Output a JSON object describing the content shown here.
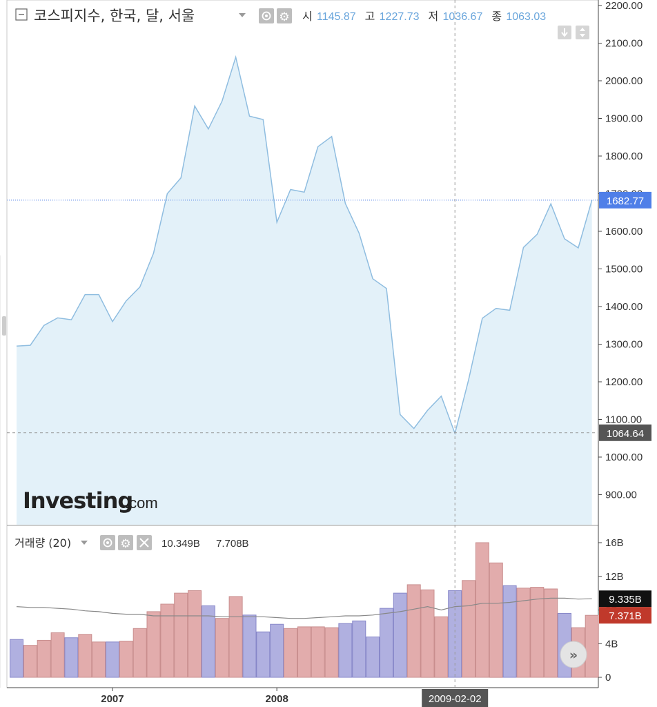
{
  "header": {
    "title": "코스피지수, 한국, 달, 서울",
    "ohlc": [
      {
        "label": "시",
        "value": "1145.87"
      },
      {
        "label": "고",
        "value": "1227.73"
      },
      {
        "label": "저",
        "value": "1036.67"
      },
      {
        "label": "종",
        "value": "1063.03"
      }
    ]
  },
  "volume_header": {
    "title": "거래량 (20)",
    "value1": "10.349B",
    "value2": "7.708B"
  },
  "watermark": {
    "brand": "Investing",
    "suffix": ".com"
  },
  "crosshair": {
    "date_label": "2009-02-02",
    "price_label": "1064.64"
  },
  "last_price_label": "1682.77",
  "volume_labels": {
    "ma": "9.335B",
    "last": "7.371B"
  },
  "colors": {
    "price_line": "#8fbde0",
    "price_fill": "#e3f1f9",
    "vol_up": "#b0b0e0",
    "vol_down": "#e2acac",
    "vol_ma": "#888888",
    "last_tag": "#4f7fe8",
    "cross_tag": "#555555",
    "vma_tag": "#111111",
    "vlast_tag": "#c0392b"
  },
  "chart_data": [
    {
      "type": "area",
      "title": "코스피지수, 한국, 달, 서울",
      "x": [
        "2006-06",
        "2006-07",
        "2006-08",
        "2006-09",
        "2006-10",
        "2006-11",
        "2006-12",
        "2007-01",
        "2007-02",
        "2007-03",
        "2007-04",
        "2007-05",
        "2007-06",
        "2007-07",
        "2007-08",
        "2007-09",
        "2007-10",
        "2007-11",
        "2007-12",
        "2008-01",
        "2008-02",
        "2008-03",
        "2008-04",
        "2008-05",
        "2008-06",
        "2008-07",
        "2008-08",
        "2008-09",
        "2008-10",
        "2008-11",
        "2008-12",
        "2009-01",
        "2009-02",
        "2009-03",
        "2009-04",
        "2009-05",
        "2009-06",
        "2009-07",
        "2009-08",
        "2009-09",
        "2009-10",
        "2009-11"
      ],
      "series": [
        {
          "values": [
            1295,
            1297,
            1350,
            1370,
            1365,
            1432,
            1432,
            1360,
            1415,
            1452,
            1542,
            1700,
            1742,
            1933,
            1872,
            1946,
            2063,
            1906,
            1897,
            1624,
            1711,
            1704,
            1825,
            1852,
            1674,
            1595,
            1474,
            1448,
            1113,
            1076,
            1124,
            1162,
            1063,
            1206,
            1369,
            1395,
            1390,
            1557,
            1592,
            1673,
            1580,
            1556,
            1683
          ]
        }
      ],
      "xticks": [
        "2007",
        "2008",
        "2009-02-02"
      ],
      "yticks": [
        900,
        1000,
        1100,
        1200,
        1300,
        1400,
        1500,
        1600,
        1700,
        1800,
        1900,
        2000,
        2100,
        2200
      ],
      "ylim": [
        820,
        2220
      ],
      "grid": false
    },
    {
      "type": "bar",
      "title": "거래량 (20)",
      "unit": "B",
      "series": [
        {
          "values": [
            4.5,
            3.8,
            4.4,
            5.3,
            4.7,
            5.1,
            4.2,
            4.2,
            4.3,
            5.8,
            7.8,
            8.7,
            10.0,
            10.3,
            8.5,
            7.0,
            9.6,
            7.4,
            5.4,
            6.3,
            5.8,
            6.0,
            6.0,
            5.9,
            6.4,
            6.7,
            4.8,
            8.2,
            10.0,
            11.0,
            10.4,
            7.2,
            10.3,
            11.5,
            16.0,
            13.6,
            10.9,
            10.6,
            10.7,
            10.5,
            7.6,
            5.9,
            7.371
          ]
        }
      ],
      "up_down": [
        "u",
        "d",
        "d",
        "d",
        "u",
        "d",
        "d",
        "u",
        "d",
        "d",
        "d",
        "d",
        "d",
        "d",
        "u",
        "d",
        "d",
        "u",
        "u",
        "u",
        "d",
        "d",
        "d",
        "d",
        "u",
        "u",
        "u",
        "u",
        "u",
        "d",
        "d",
        "d",
        "u",
        "d",
        "d",
        "d",
        "u",
        "d",
        "d",
        "d",
        "u",
        "d",
        "d"
      ],
      "ma": [
        8.4,
        8.3,
        8.3,
        8.2,
        8.1,
        7.9,
        7.8,
        7.6,
        7.5,
        7.5,
        7.3,
        7.3,
        7.3,
        7.3,
        7.3,
        7.2,
        7.2,
        7.2,
        7.2,
        7.1,
        7.0,
        7.0,
        7.1,
        7.2,
        7.3,
        7.3,
        7.4,
        7.6,
        7.8,
        8.1,
        8.4,
        8.0,
        8.4,
        8.5,
        8.8,
        8.8,
        8.9,
        9.1,
        9.3,
        9.4,
        9.4,
        9.3,
        9.335
      ],
      "yticks": [
        0,
        4,
        8,
        12,
        16
      ],
      "ytick_labels": [
        "0",
        "4B",
        "8B",
        "12B",
        "16B"
      ],
      "ylim": [
        0,
        16.5
      ]
    }
  ]
}
